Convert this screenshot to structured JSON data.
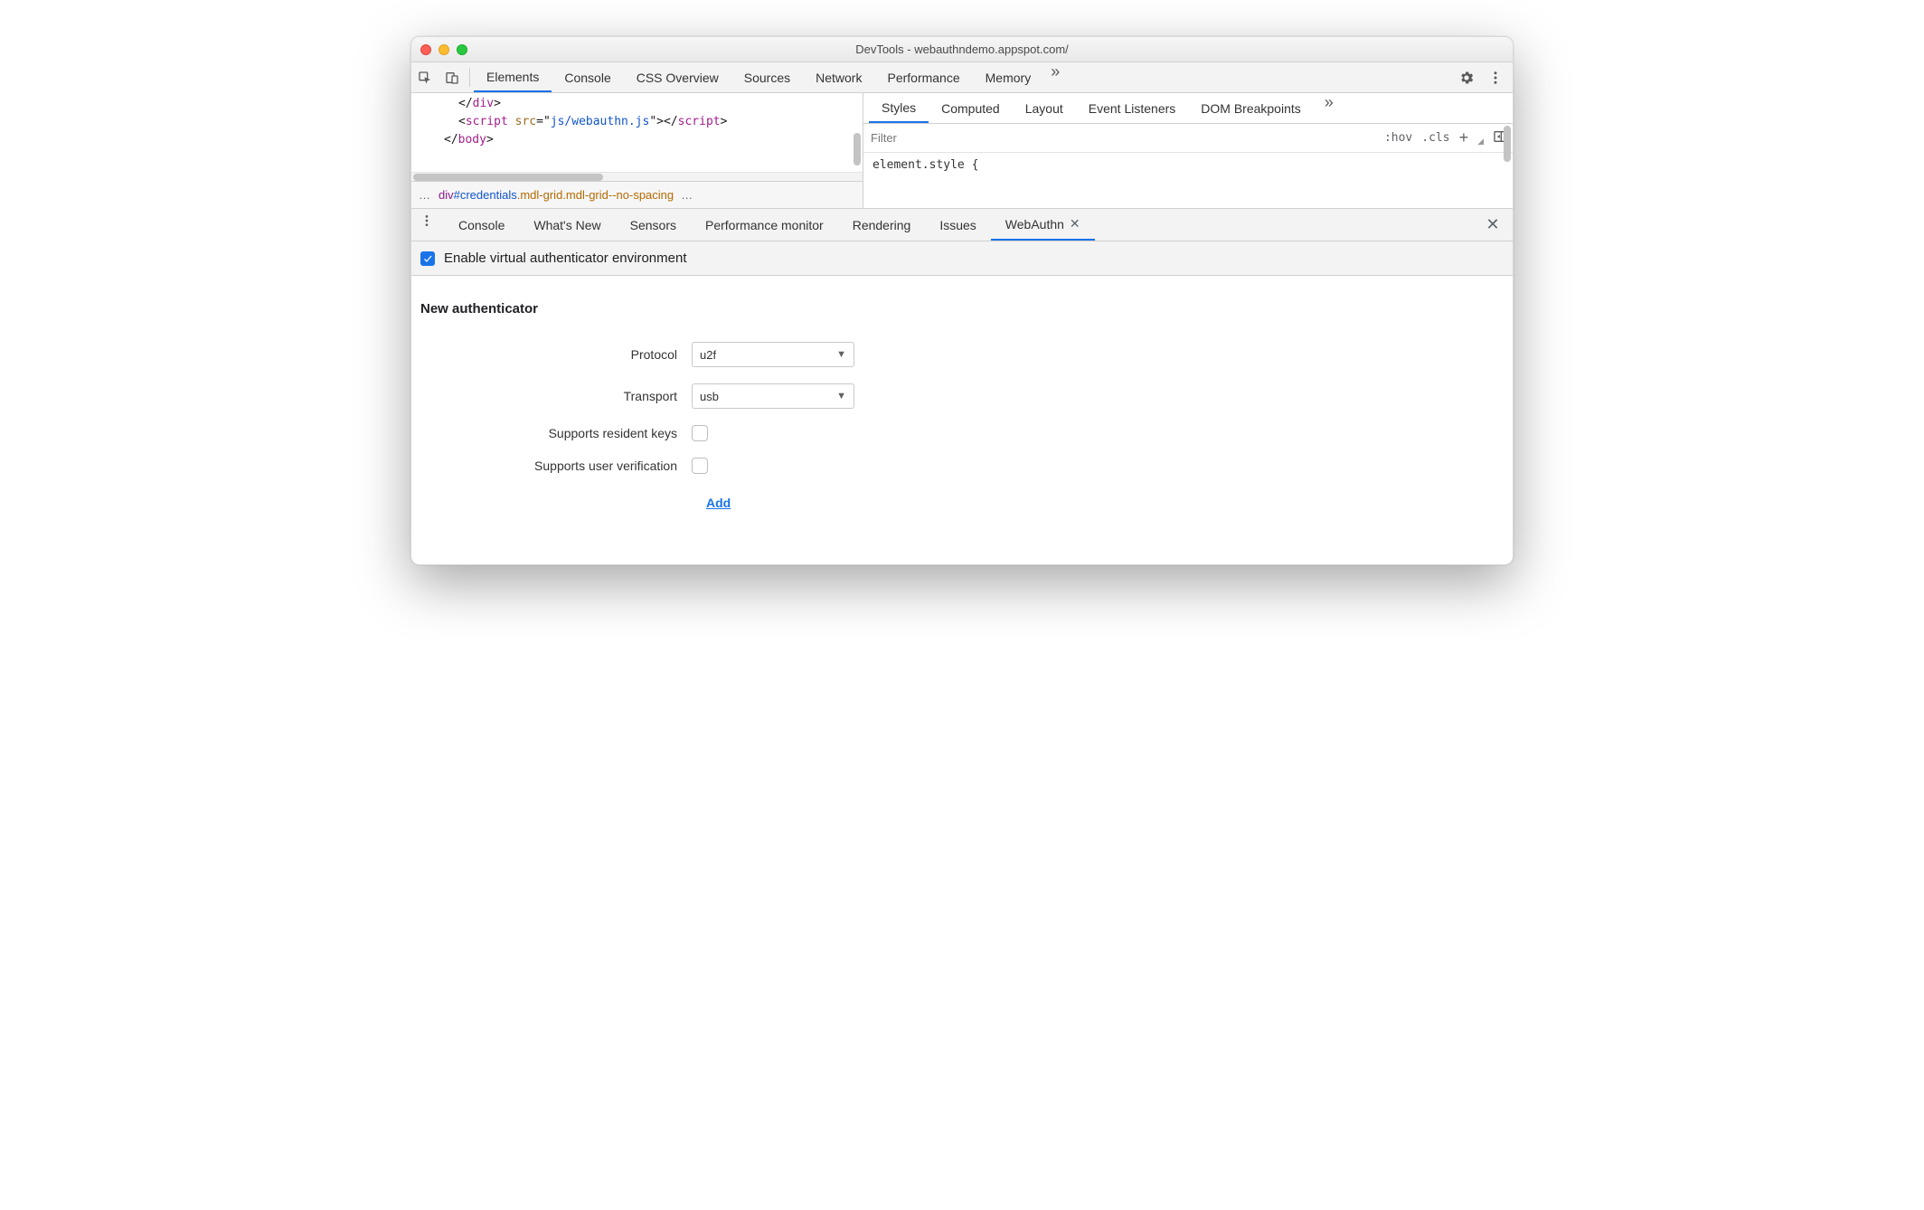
{
  "window": {
    "title": "DevTools - webauthndemo.appspot.com/"
  },
  "mainTabs": {
    "items": [
      "Elements",
      "Console",
      "CSS Overview",
      "Sources",
      "Network",
      "Performance",
      "Memory"
    ],
    "activeIndex": 0,
    "moreGlyph": "»"
  },
  "code": {
    "lines": [
      {
        "indent": 2,
        "raw": "</div>",
        "tokens": [
          [
            "punc",
            "</"
          ],
          [
            "tag",
            "div"
          ],
          [
            "punc",
            ">"
          ]
        ]
      },
      {
        "indent": 2,
        "raw": "<script src=\"js/webauthn.js\"></script>",
        "tokens": [
          [
            "punc",
            "<"
          ],
          [
            "tag",
            "script"
          ],
          [
            "plain",
            " "
          ],
          [
            "attr",
            "src"
          ],
          [
            "punc",
            "="
          ],
          [
            "punc",
            "\""
          ],
          [
            "str",
            "js/webauthn.js"
          ],
          [
            "punc",
            "\""
          ],
          [
            "punc",
            ">"
          ],
          [
            "punc",
            "</"
          ],
          [
            "tag",
            "script"
          ],
          [
            "punc",
            ">"
          ]
        ]
      },
      {
        "indent": 1,
        "raw": "</body>",
        "tokens": [
          [
            "punc",
            "</"
          ],
          [
            "tag",
            "body"
          ],
          [
            "punc",
            ">"
          ]
        ]
      }
    ]
  },
  "breadcrumb": {
    "leading": "…",
    "element": "div",
    "id": "#credentials",
    "classes": ".mdl-grid.mdl-grid--no-spacing",
    "trailing": "…"
  },
  "stylesTabs": {
    "items": [
      "Styles",
      "Computed",
      "Layout",
      "Event Listeners",
      "DOM Breakpoints"
    ],
    "activeIndex": 0,
    "moreGlyph": "»"
  },
  "filterRow": {
    "placeholder": "Filter",
    "hov": ":hov",
    "cls": ".cls",
    "plus": "+"
  },
  "styleBody": {
    "text": "element.style {"
  },
  "drawerTabs": {
    "items": [
      "Console",
      "What's New",
      "Sensors",
      "Performance monitor",
      "Rendering",
      "Issues",
      "WebAuthn"
    ],
    "activeIndex": 6,
    "closableIndex": 6
  },
  "toolbar": {
    "enableLabel": "Enable virtual authenticator environment",
    "checked": true
  },
  "webauthn": {
    "heading": "New authenticator",
    "rows": {
      "protocol": {
        "label": "Protocol",
        "value": "u2f"
      },
      "transport": {
        "label": "Transport",
        "value": "usb"
      },
      "residentKeys": {
        "label": "Supports resident keys"
      },
      "userVerification": {
        "label": "Supports user verification"
      }
    },
    "addLabel": "Add"
  }
}
